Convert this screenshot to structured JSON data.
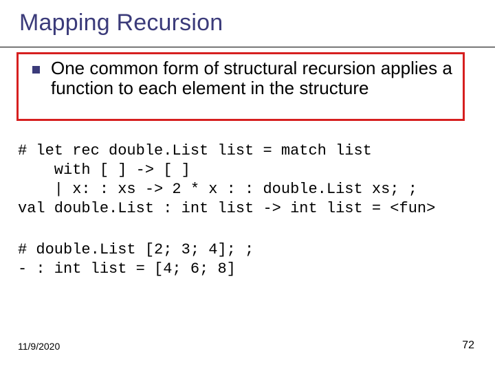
{
  "title": "Mapping Recursion",
  "bullet": {
    "text": "One common form of structural recursion applies a function to each element in the structure"
  },
  "code": {
    "block1": "# let rec double.List list = match list\n    with [ ] -> [ ]\n    | x: : xs -> 2 * x : : double.List xs; ;\nval double.List : int list -> int list = <fun>",
    "block2": "# double.List [2; 3; 4]; ;\n- : int list = [4; 6; 8]"
  },
  "footer": {
    "date": "11/9/2020",
    "page": "72"
  }
}
